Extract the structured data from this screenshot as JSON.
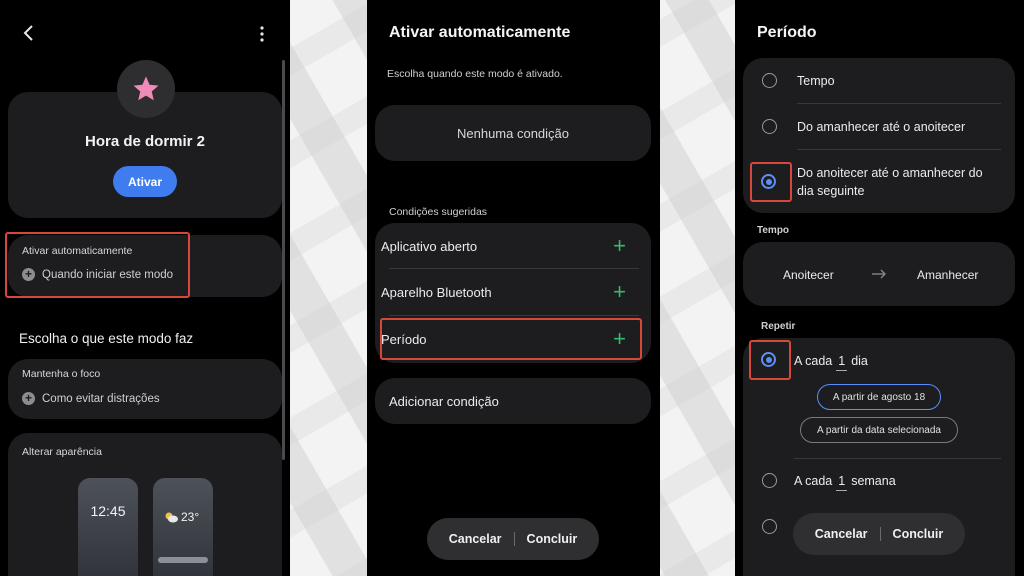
{
  "screen1": {
    "mode_title": "Hora de dormir 2",
    "activate_label": "Ativar",
    "auto_label": "Ativar automaticamente",
    "auto_row": "Quando iniciar este modo",
    "choose_heading": "Escolha o que este modo faz",
    "focus_label": "Mantenha o foco",
    "focus_row": "Como evitar distrações",
    "appearance_label": "Alterar aparência",
    "clock_time": "12:45",
    "weather_temp": "23°"
  },
  "screen2": {
    "title": "Ativar automaticamente",
    "subtitle": "Escolha quando este modo é ativado.",
    "no_condition": "Nenhuma condição",
    "suggested_label": "Condições sugeridas",
    "suggestions": [
      {
        "label": "Aplicativo aberto"
      },
      {
        "label": "Aparelho Bluetooth"
      },
      {
        "label": "Período"
      }
    ],
    "add_condition": "Adicionar condição",
    "cancel_label": "Cancelar",
    "done_label": "Concluir"
  },
  "screen3": {
    "title": "Período",
    "options": [
      {
        "label": "Tempo",
        "selected": false
      },
      {
        "label": "Do amanhecer até o anoitecer",
        "selected": false
      },
      {
        "label": "Do anoitecer até o amanhecer do dia seguinte",
        "selected": true
      }
    ],
    "time_label": "Tempo",
    "time_start": "Anoitecer",
    "time_end": "Amanhecer",
    "repeat_label": "Repetir",
    "repeat_daily": {
      "prefix": "A cada",
      "number": "1",
      "unit": "dia"
    },
    "chip_from_date": "A partir de agosto 18",
    "chip_from_selected": "A partir da data selecionada",
    "repeat_weekly": {
      "prefix": "A cada",
      "number": "1",
      "unit": "semana"
    },
    "cancel_label": "Cancelar",
    "done_label": "Concluir"
  },
  "colors": {
    "accent_blue": "#3e7cf0",
    "highlight_red": "#d8473a",
    "plus_green": "#39b86a",
    "star_pink": "#f08ab8"
  }
}
